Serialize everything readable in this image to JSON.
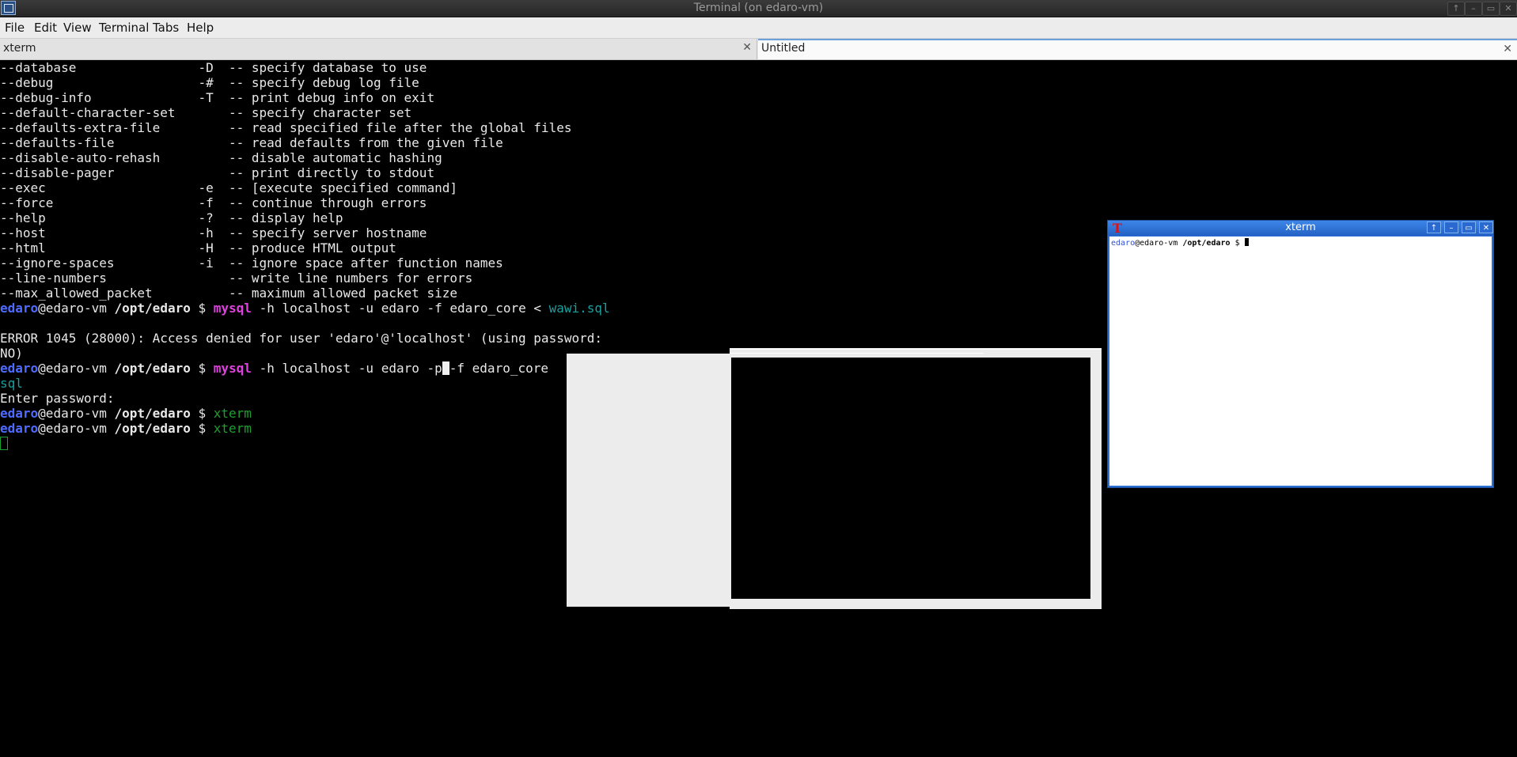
{
  "window": {
    "title": "Terminal (on edaro-vm)",
    "buttons": [
      "↑",
      "–",
      "▭",
      "✕"
    ]
  },
  "menubar": {
    "items": [
      "File",
      "Edit",
      "View",
      "Terminal",
      "Tabs",
      "Help"
    ]
  },
  "tabs": [
    {
      "label": "xterm",
      "close": "✕"
    },
    {
      "label": "Untitled",
      "close": "✕"
    }
  ],
  "terminal": {
    "options": [
      "--database                -D  -- specify database to use",
      "--debug                   -#  -- specify debug log file",
      "--debug-info              -T  -- print debug info on exit",
      "--default-character-set       -- specify character set",
      "--defaults-extra-file         -- read specified file after the global files",
      "--defaults-file               -- read defaults from the given file",
      "--disable-auto-rehash         -- disable automatic hashing",
      "--disable-pager               -- print directly to stdout",
      "--exec                    -e  -- [execute specified command]",
      "--force                   -f  -- continue through errors",
      "--help                    -?  -- display help",
      "--host                    -h  -- specify server hostname",
      "--html                    -H  -- produce HTML output",
      "--ignore-spaces           -i  -- ignore space after function names",
      "--line-numbers                -- write line numbers for errors",
      "--max_allowed_packet          -- maximum allowed packet size"
    ],
    "prompt": {
      "user": "edaro",
      "host": "@edaro-vm",
      "path": "/opt/edaro",
      "symbol": "$"
    },
    "cmd1": {
      "cmd": "mysql",
      "args": " -h localhost -u edaro -f edaro_core < ",
      "file": "wawi.sql"
    },
    "error1": "ERROR 1045 (28000): Access denied for user 'edaro'@'localhost' (using password:",
    "error2": "NO)",
    "cmd2": {
      "cmd": "mysql",
      "args_before": " -h localhost -u edaro -p",
      "args_after": "-f edaro_core"
    },
    "wrap": "sql",
    "enter_password": "Enter password:",
    "cmd3": "xterm",
    "cmd4": "xterm"
  },
  "xterm": {
    "title": "xterm",
    "icon": "T",
    "buttons": [
      "↑",
      "–",
      "▭",
      "✕"
    ],
    "prompt_user": "edaro",
    "prompt_host": "@edaro-vm",
    "prompt_path": "/opt/edaro",
    "prompt_symbol": "$"
  }
}
